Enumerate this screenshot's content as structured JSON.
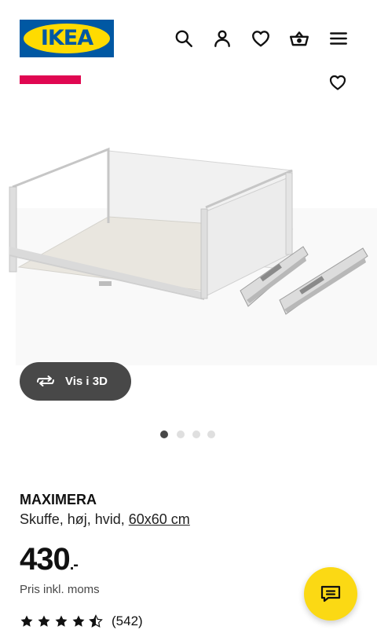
{
  "header": {
    "logo_text": "IKEA",
    "icons": [
      "search-icon",
      "account-icon",
      "favorites-icon",
      "cart-icon",
      "menu-icon"
    ]
  },
  "media": {
    "view_3d_label": "Vis i 3D",
    "dots_count": 4,
    "active_dot": 0
  },
  "product": {
    "name": "MAXIMERA",
    "description": "Skuffe, høj, hvid, ",
    "size": "60x60 cm",
    "price": "430",
    "price_suffix": ".-",
    "vat_note": "Pris inkl. moms",
    "rating": 4.5,
    "review_count": "(542)"
  },
  "colors": {
    "ikea_blue": "#0058a3",
    "ikea_yellow": "#ffdb00",
    "badge_red": "#e00751",
    "chat_yellow": "#fbd914",
    "button_dark": "#484848"
  }
}
